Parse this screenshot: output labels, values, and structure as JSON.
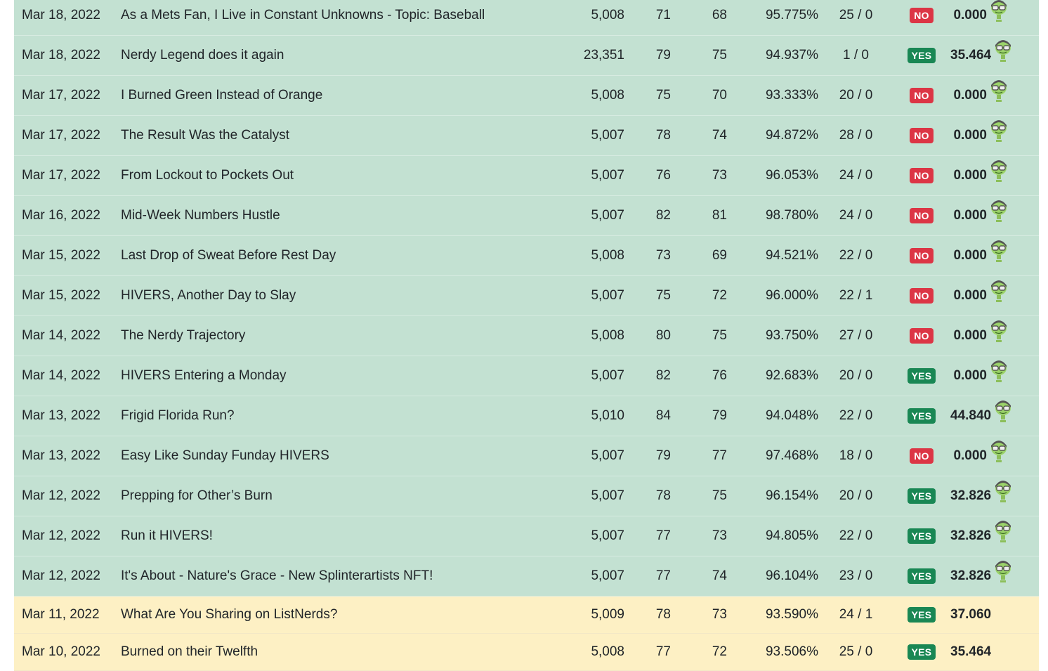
{
  "posts": [
    {
      "date": "Mar 18, 2022",
      "title": "As a Mets Fan, I Live in Constant Unknowns - Topic: Baseball",
      "words": "5,008",
      "c1": "71",
      "c2": "68",
      "pct": "95.775%",
      "ratio": "25 / 0",
      "status": "NO",
      "payout": "0.000",
      "icon": "nerd-avatar-icon"
    },
    {
      "date": "Mar 18, 2022",
      "title": "Nerdy Legend does it again",
      "words": "23,351",
      "c1": "79",
      "c2": "75",
      "pct": "94.937%",
      "ratio": "1 / 0",
      "status": "YES",
      "payout": "35.464",
      "icon": "nerd-avatar-icon"
    },
    {
      "date": "Mar 17, 2022",
      "title": "I Burned Green Instead of Orange",
      "words": "5,008",
      "c1": "75",
      "c2": "70",
      "pct": "93.333%",
      "ratio": "20 / 0",
      "status": "NO",
      "payout": "0.000",
      "icon": "nerd-avatar-icon"
    },
    {
      "date": "Mar 17, 2022",
      "title": "The Result Was the Catalyst",
      "words": "5,007",
      "c1": "78",
      "c2": "74",
      "pct": "94.872%",
      "ratio": "28 / 0",
      "status": "NO",
      "payout": "0.000",
      "icon": "nerd-avatar-icon"
    },
    {
      "date": "Mar 17, 2022",
      "title": "From Lockout to Pockets Out",
      "words": "5,007",
      "c1": "76",
      "c2": "73",
      "pct": "96.053%",
      "ratio": "24 / 0",
      "status": "NO",
      "payout": "0.000",
      "icon": "nerd-avatar-icon"
    },
    {
      "date": "Mar 16, 2022",
      "title": "Mid-Week Numbers Hustle",
      "words": "5,007",
      "c1": "82",
      "c2": "81",
      "pct": "98.780%",
      "ratio": "24 / 0",
      "status": "NO",
      "payout": "0.000",
      "icon": "nerd-avatar-icon"
    },
    {
      "date": "Mar 15, 2022",
      "title": "Last Drop of Sweat Before Rest Day",
      "words": "5,008",
      "c1": "73",
      "c2": "69",
      "pct": "94.521%",
      "ratio": "22 / 0",
      "status": "NO",
      "payout": "0.000",
      "icon": "nerd-avatar-icon"
    },
    {
      "date": "Mar 15, 2022",
      "title": "HIVERS, Another Day to Slay",
      "words": "5,007",
      "c1": "75",
      "c2": "72",
      "pct": "96.000%",
      "ratio": "22 / 1",
      "status": "NO",
      "payout": "0.000",
      "icon": "nerd-avatar-icon"
    },
    {
      "date": "Mar 14, 2022",
      "title": "The Nerdy Trajectory",
      "words": "5,008",
      "c1": "80",
      "c2": "75",
      "pct": "93.750%",
      "ratio": "27 / 0",
      "status": "NO",
      "payout": "0.000",
      "icon": "nerd-avatar-icon"
    },
    {
      "date": "Mar 14, 2022",
      "title": "HIVERS Entering a Monday",
      "words": "5,007",
      "c1": "82",
      "c2": "76",
      "pct": "92.683%",
      "ratio": "20 / 0",
      "status": "YES",
      "payout": "0.000",
      "icon": "nerd-avatar-icon"
    },
    {
      "date": "Mar 13, 2022",
      "title": "Frigid Florida Run?",
      "words": "5,010",
      "c1": "84",
      "c2": "79",
      "pct": "94.048%",
      "ratio": "22 / 0",
      "status": "YES",
      "payout": "44.840",
      "icon": "nerd-avatar-icon"
    },
    {
      "date": "Mar 13, 2022",
      "title": "Easy Like Sunday Funday HIVERS",
      "words": "5,007",
      "c1": "79",
      "c2": "77",
      "pct": "97.468%",
      "ratio": "18 / 0",
      "status": "NO",
      "payout": "0.000",
      "icon": "nerd-avatar-icon"
    },
    {
      "date": "Mar 12, 2022",
      "title": "Prepping for Other’s Burn",
      "words": "5,007",
      "c1": "78",
      "c2": "75",
      "pct": "96.154%",
      "ratio": "20 / 0",
      "status": "YES",
      "payout": "32.826",
      "icon": "nerd-avatar-icon"
    },
    {
      "date": "Mar 12, 2022",
      "title": "Run it HIVERS!",
      "words": "5,007",
      "c1": "77",
      "c2": "73",
      "pct": "94.805%",
      "ratio": "22 / 0",
      "status": "YES",
      "payout": "32.826",
      "icon": "nerd-avatar-icon"
    },
    {
      "date": "Mar 12, 2022",
      "title": "It's About - Nature's Grace - New Splinterartists NFT!",
      "words": "5,007",
      "c1": "77",
      "c2": "74",
      "pct": "96.104%",
      "ratio": "23 / 0",
      "status": "YES",
      "payout": "32.826",
      "icon": "nerd-avatar-icon"
    },
    {
      "date": "Mar 11, 2022",
      "title": "What Are You Sharing on ListNerds?",
      "words": "5,009",
      "c1": "78",
      "c2": "73",
      "pct": "93.590%",
      "ratio": "24 / 1",
      "status": "YES",
      "payout": "37.060",
      "icon": ""
    },
    {
      "date": "Mar 10, 2022",
      "title": "Burned on their Twelfth",
      "words": "5,008",
      "c1": "77",
      "c2": "72",
      "pct": "93.506%",
      "ratio": "25 / 0",
      "status": "YES",
      "payout": "35.464",
      "icon": ""
    }
  ],
  "colors": {
    "row_green": "#c3e1d2",
    "row_yellow": "#fdf0c4",
    "badge_no": "#dc3545",
    "badge_yes": "#198754"
  }
}
